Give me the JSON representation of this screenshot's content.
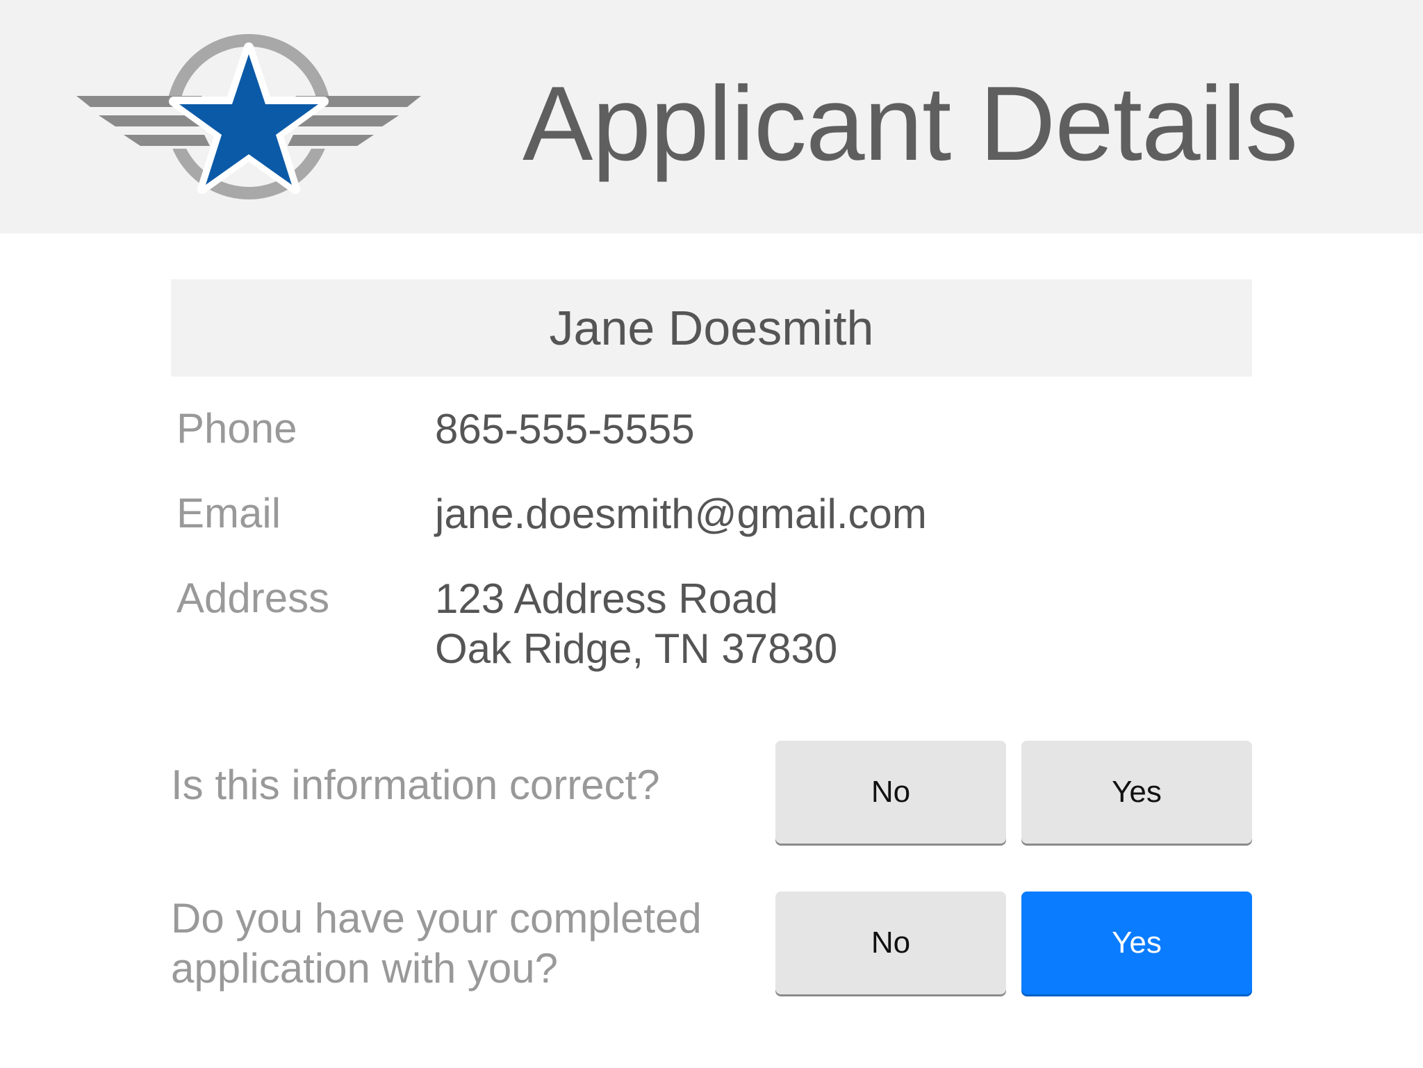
{
  "header": {
    "title": "Applicant Details",
    "logo_icon": "star-wings-logo",
    "logo_colors": {
      "star": "#0b5aa8",
      "wings": "#8a8a8a",
      "ring": "#a8a8a8"
    }
  },
  "applicant": {
    "name": "Jane Doesmith",
    "fields": {
      "phone_label": "Phone",
      "phone_value": "865-555-5555",
      "email_label": "Email",
      "email_value": "jane.doesmith@gmail.com",
      "address_label": "Address",
      "address_line1": "123 Address Road",
      "address_line2": "Oak Ridge, TN 37830"
    }
  },
  "questions": [
    {
      "text": "Is this information correct?",
      "no_label": "No",
      "yes_label": "Yes",
      "selected": null
    },
    {
      "text": "Do you have your completed application with you?",
      "no_label": "No",
      "yes_label": "Yes",
      "selected": "Yes"
    }
  ],
  "colors": {
    "header_bg": "#f2f2f2",
    "button_bg": "#e5e5e5",
    "selected_button_bg": "#0a7cff",
    "label_text": "#999999",
    "value_text": "#555555"
  }
}
